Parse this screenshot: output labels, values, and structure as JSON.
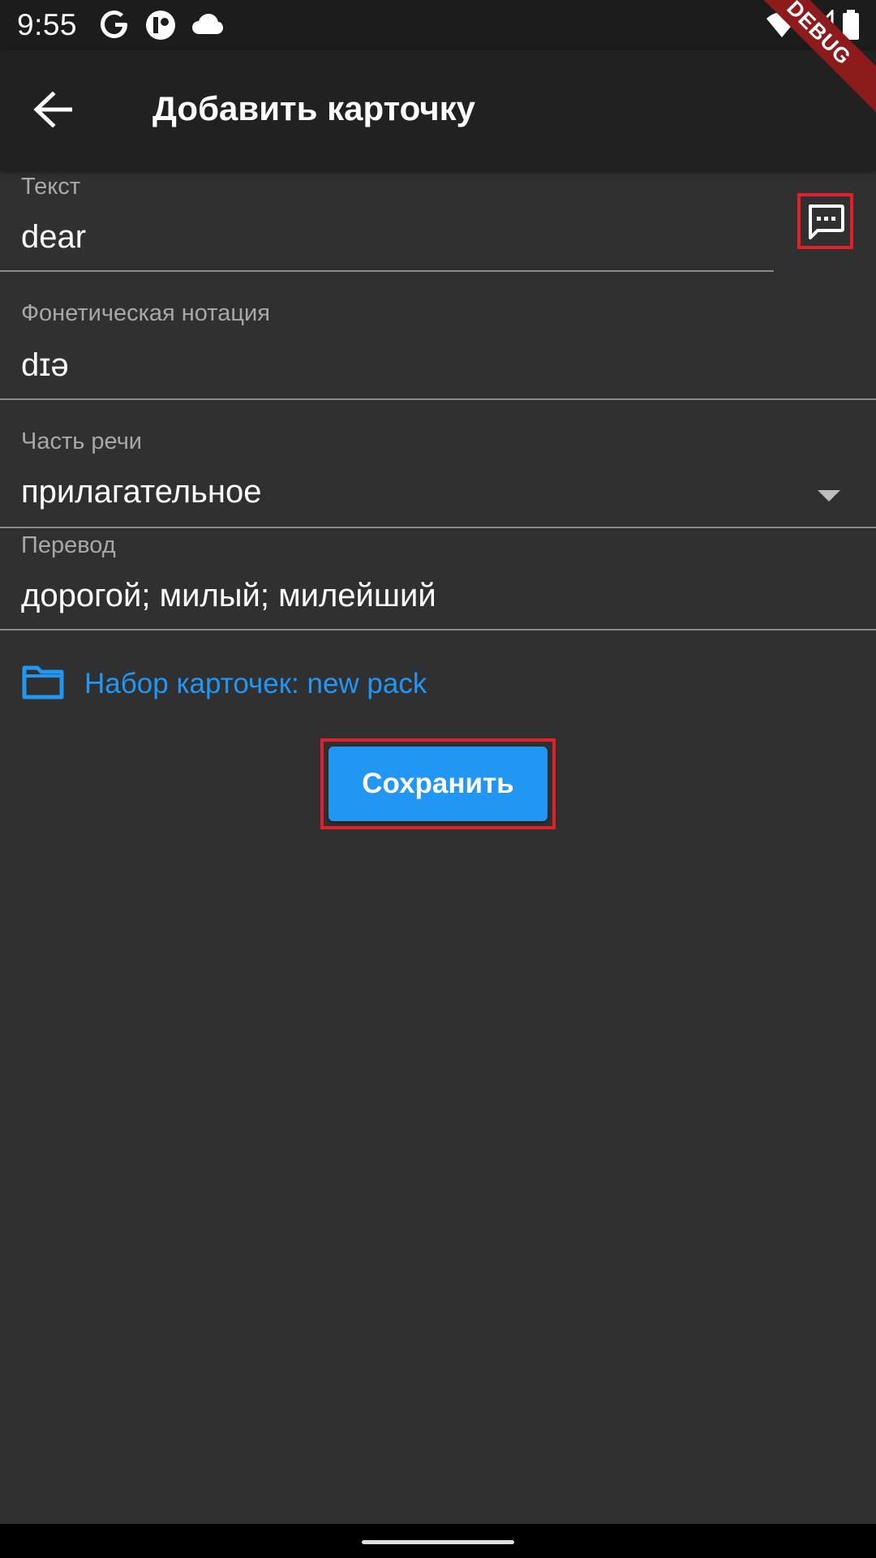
{
  "status_bar": {
    "time": "9:55",
    "icons": [
      "google-icon",
      "app-icon",
      "cloud-icon",
      "wifi-icon",
      "signal-icon",
      "battery-icon"
    ]
  },
  "debug_banner": "DEBUG",
  "app_bar": {
    "back_icon": "arrow-left-icon",
    "title": "Добавить карточку"
  },
  "fields": {
    "text": {
      "label": "Текст",
      "value": "dear"
    },
    "phonetic": {
      "label": "Фонетическая нотация",
      "value": "dɪə"
    },
    "part_of_speech": {
      "label": "Часть речи",
      "value": "прилагательное"
    },
    "translation": {
      "label": "Перевод",
      "value": "дорогой; милый; милейший"
    }
  },
  "examples_icon": "message-dots-icon",
  "pack": {
    "icon": "folder-icon",
    "label": "Набор карточек: new pack"
  },
  "save_button": {
    "label": "Сохранить"
  },
  "colors": {
    "accent": "#2196f3",
    "highlight": "#e0202a",
    "background": "#303030",
    "app_bar": "#212121"
  }
}
